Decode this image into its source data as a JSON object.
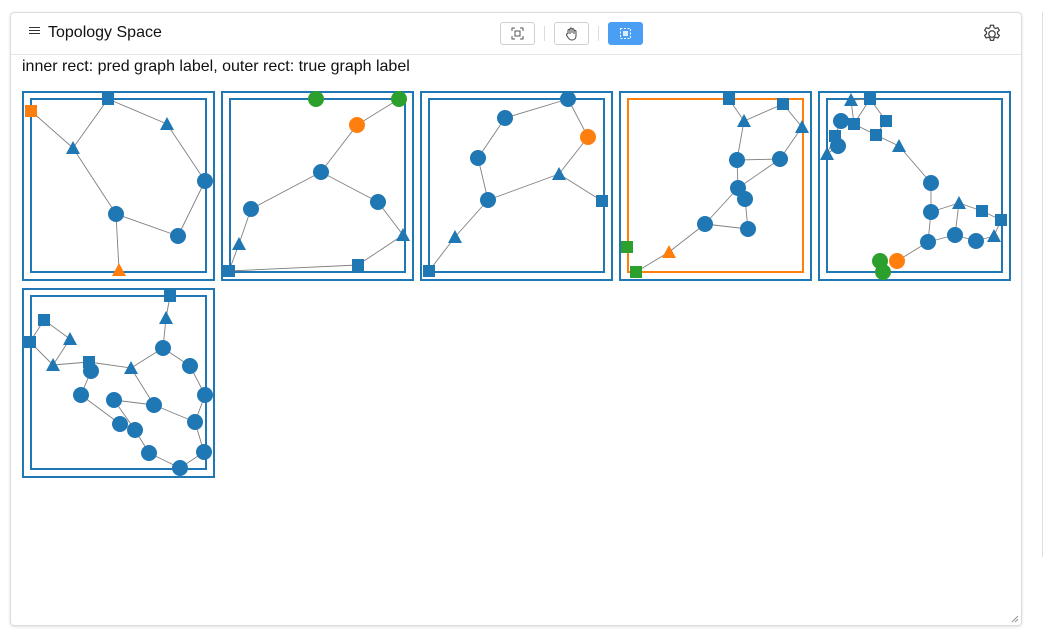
{
  "header": {
    "title": "Topology Space",
    "buttons": [
      {
        "name": "fit-view-button",
        "icon": "fit-view-icon"
      },
      {
        "name": "pan-tool-button",
        "icon": "hand-icon"
      },
      {
        "name": "select-tool-button",
        "icon": "select-area-icon",
        "active": true
      }
    ],
    "settings_icon": "gear-icon"
  },
  "legend_text": "inner rect: pred graph label, outer rect: true graph label",
  "colors": {
    "blue": "#1f77b4",
    "orange": "#ff7f0e",
    "green": "#2ca02c",
    "edge": "#7f7f7f",
    "accent": "#4a9ff5"
  },
  "graphs": [
    {
      "outer": "blue",
      "inner": "blue",
      "nodes": [
        [
          9,
          20,
          "square",
          "orange"
        ],
        [
          86,
          8,
          "square",
          "blue"
        ],
        [
          145,
          33,
          "triangle",
          "blue"
        ],
        [
          51,
          57,
          "triangle",
          "blue"
        ],
        [
          183,
          90,
          "circle",
          "blue"
        ],
        [
          94,
          123,
          "circle",
          "blue"
        ],
        [
          156,
          145,
          "circle",
          "blue"
        ],
        [
          97,
          179,
          "triangle",
          "orange"
        ]
      ],
      "edges": [
        [
          1,
          2
        ],
        [
          1,
          3
        ],
        [
          0,
          3
        ],
        [
          3,
          5
        ],
        [
          2,
          4
        ],
        [
          4,
          6
        ],
        [
          5,
          6
        ],
        [
          5,
          7
        ]
      ]
    },
    {
      "outer": "blue",
      "inner": "blue",
      "nodes": [
        [
          95,
          8,
          "circle",
          "green"
        ],
        [
          178,
          8,
          "circle",
          "green"
        ],
        [
          136,
          34,
          "circle",
          "orange"
        ],
        [
          100,
          81,
          "circle",
          "blue"
        ],
        [
          30,
          118,
          "circle",
          "blue"
        ],
        [
          157,
          111,
          "circle",
          "blue"
        ],
        [
          18,
          153,
          "triangle",
          "blue"
        ],
        [
          182,
          144,
          "triangle",
          "blue"
        ],
        [
          137,
          174,
          "square",
          "blue"
        ],
        [
          8,
          180,
          "square",
          "blue"
        ]
      ],
      "edges": [
        [
          1,
          2
        ],
        [
          2,
          3
        ],
        [
          3,
          4
        ],
        [
          3,
          5
        ],
        [
          4,
          6
        ],
        [
          6,
          9
        ],
        [
          9,
          8
        ],
        [
          5,
          7
        ],
        [
          8,
          7
        ]
      ]
    },
    {
      "outer": "blue",
      "inner": "blue",
      "nodes": [
        [
          148,
          8,
          "circle",
          "blue"
        ],
        [
          85,
          27,
          "circle",
          "blue"
        ],
        [
          168,
          46,
          "circle",
          "orange"
        ],
        [
          58,
          67,
          "circle",
          "blue"
        ],
        [
          139,
          83,
          "triangle",
          "blue"
        ],
        [
          68,
          109,
          "circle",
          "blue"
        ],
        [
          182,
          110,
          "square",
          "blue"
        ],
        [
          35,
          146,
          "triangle",
          "blue"
        ],
        [
          9,
          180,
          "square",
          "blue"
        ]
      ],
      "edges": [
        [
          0,
          1
        ],
        [
          0,
          2
        ],
        [
          1,
          3
        ],
        [
          3,
          5
        ],
        [
          2,
          4
        ],
        [
          4,
          5
        ],
        [
          4,
          6
        ],
        [
          5,
          7
        ],
        [
          7,
          8
        ]
      ]
    },
    {
      "outer": "blue",
      "inner": "orange",
      "nodes": [
        [
          110,
          8,
          "square",
          "blue"
        ],
        [
          164,
          13,
          "square",
          "blue"
        ],
        [
          125,
          30,
          "triangle",
          "blue"
        ],
        [
          183,
          36,
          "triangle",
          "blue"
        ],
        [
          118,
          69,
          "circle",
          "blue"
        ],
        [
          161,
          68,
          "circle",
          "blue"
        ],
        [
          119,
          97,
          "circle",
          "blue"
        ],
        [
          126,
          108,
          "circle",
          "blue"
        ],
        [
          86,
          133,
          "circle",
          "blue"
        ],
        [
          129,
          138,
          "circle",
          "blue"
        ],
        [
          50,
          161,
          "triangle",
          "orange"
        ],
        [
          8,
          156,
          "square",
          "green"
        ],
        [
          17,
          181,
          "square",
          "green"
        ]
      ],
      "edges": [
        [
          0,
          2
        ],
        [
          1,
          2
        ],
        [
          1,
          3
        ],
        [
          2,
          4
        ],
        [
          3,
          5
        ],
        [
          4,
          5
        ],
        [
          4,
          6
        ],
        [
          5,
          6
        ],
        [
          6,
          7
        ],
        [
          6,
          8
        ],
        [
          7,
          9
        ],
        [
          8,
          9
        ],
        [
          8,
          10
        ],
        [
          10,
          17
        ],
        [
          10,
          12
        ]
      ]
    },
    {
      "outer": "blue",
      "inner": "blue",
      "nodes": [
        [
          33,
          9,
          "triangle",
          "blue"
        ],
        [
          52,
          8,
          "square",
          "blue"
        ],
        [
          23,
          30,
          "circle",
          "blue"
        ],
        [
          36,
          33,
          "square",
          "blue"
        ],
        [
          68,
          30,
          "square",
          "blue"
        ],
        [
          17,
          45,
          "square",
          "blue"
        ],
        [
          20,
          55,
          "circle",
          "blue"
        ],
        [
          58,
          44,
          "square",
          "blue"
        ],
        [
          81,
          55,
          "triangle",
          "blue"
        ],
        [
          9,
          63,
          "triangle",
          "blue"
        ],
        [
          113,
          92,
          "circle",
          "blue"
        ],
        [
          113,
          121,
          "circle",
          "blue"
        ],
        [
          141,
          112,
          "triangle",
          "blue"
        ],
        [
          164,
          120,
          "square",
          "blue"
        ],
        [
          183,
          129,
          "square",
          "blue"
        ],
        [
          176,
          145,
          "triangle",
          "blue"
        ],
        [
          137,
          144,
          "circle",
          "blue"
        ],
        [
          110,
          151,
          "circle",
          "blue"
        ],
        [
          158,
          150,
          "circle",
          "blue"
        ],
        [
          62,
          170,
          "circle",
          "green"
        ],
        [
          79,
          170,
          "circle",
          "orange"
        ],
        [
          65,
          181,
          "circle",
          "green"
        ]
      ],
      "edges": [
        [
          0,
          1
        ],
        [
          1,
          3
        ],
        [
          0,
          3
        ],
        [
          2,
          3
        ],
        [
          2,
          5
        ],
        [
          3,
          7
        ],
        [
          1,
          4
        ],
        [
          4,
          7
        ],
        [
          7,
          8
        ],
        [
          8,
          10
        ],
        [
          10,
          11
        ],
        [
          11,
          17
        ],
        [
          11,
          12
        ],
        [
          12,
          13
        ],
        [
          13,
          14
        ],
        [
          14,
          15
        ],
        [
          15,
          18
        ],
        [
          12,
          16
        ],
        [
          16,
          17
        ],
        [
          16,
          18
        ],
        [
          17,
          20
        ],
        [
          5,
          9
        ],
        [
          9,
          6
        ]
      ]
    },
    {
      "outer": "blue",
      "inner": "blue",
      "nodes": [
        [
          148,
          8,
          "square",
          "blue"
        ],
        [
          22,
          32,
          "square",
          "blue"
        ],
        [
          144,
          30,
          "triangle",
          "blue"
        ],
        [
          48,
          51,
          "triangle",
          "blue"
        ],
        [
          8,
          54,
          "square",
          "blue"
        ],
        [
          141,
          60,
          "circle",
          "blue"
        ],
        [
          31,
          77,
          "triangle",
          "blue"
        ],
        [
          67,
          74,
          "square",
          "blue"
        ],
        [
          69,
          83,
          "circle",
          "blue"
        ],
        [
          109,
          80,
          "triangle",
          "blue"
        ],
        [
          168,
          78,
          "circle",
          "blue"
        ],
        [
          59,
          107,
          "circle",
          "blue"
        ],
        [
          92,
          112,
          "circle",
          "blue"
        ],
        [
          132,
          117,
          "circle",
          "blue"
        ],
        [
          183,
          107,
          "circle",
          "blue"
        ],
        [
          98,
          136,
          "circle",
          "blue"
        ],
        [
          113,
          142,
          "circle",
          "blue"
        ],
        [
          173,
          134,
          "circle",
          "blue"
        ],
        [
          127,
          165,
          "circle",
          "blue"
        ],
        [
          182,
          164,
          "circle",
          "blue"
        ],
        [
          158,
          180,
          "circle",
          "blue"
        ]
      ],
      "edges": [
        [
          0,
          2
        ],
        [
          2,
          5
        ],
        [
          5,
          9
        ],
        [
          5,
          10
        ],
        [
          1,
          3
        ],
        [
          3,
          6
        ],
        [
          4,
          6
        ],
        [
          6,
          7
        ],
        [
          7,
          9
        ],
        [
          7,
          8
        ],
        [
          8,
          11
        ],
        [
          11,
          15
        ],
        [
          9,
          13
        ],
        [
          13,
          12
        ],
        [
          12,
          16
        ],
        [
          15,
          16
        ],
        [
          16,
          18
        ],
        [
          18,
          20
        ],
        [
          13,
          17
        ],
        [
          10,
          14
        ],
        [
          14,
          17
        ],
        [
          17,
          19
        ],
        [
          19,
          20
        ],
        [
          1,
          4
        ]
      ]
    }
  ]
}
